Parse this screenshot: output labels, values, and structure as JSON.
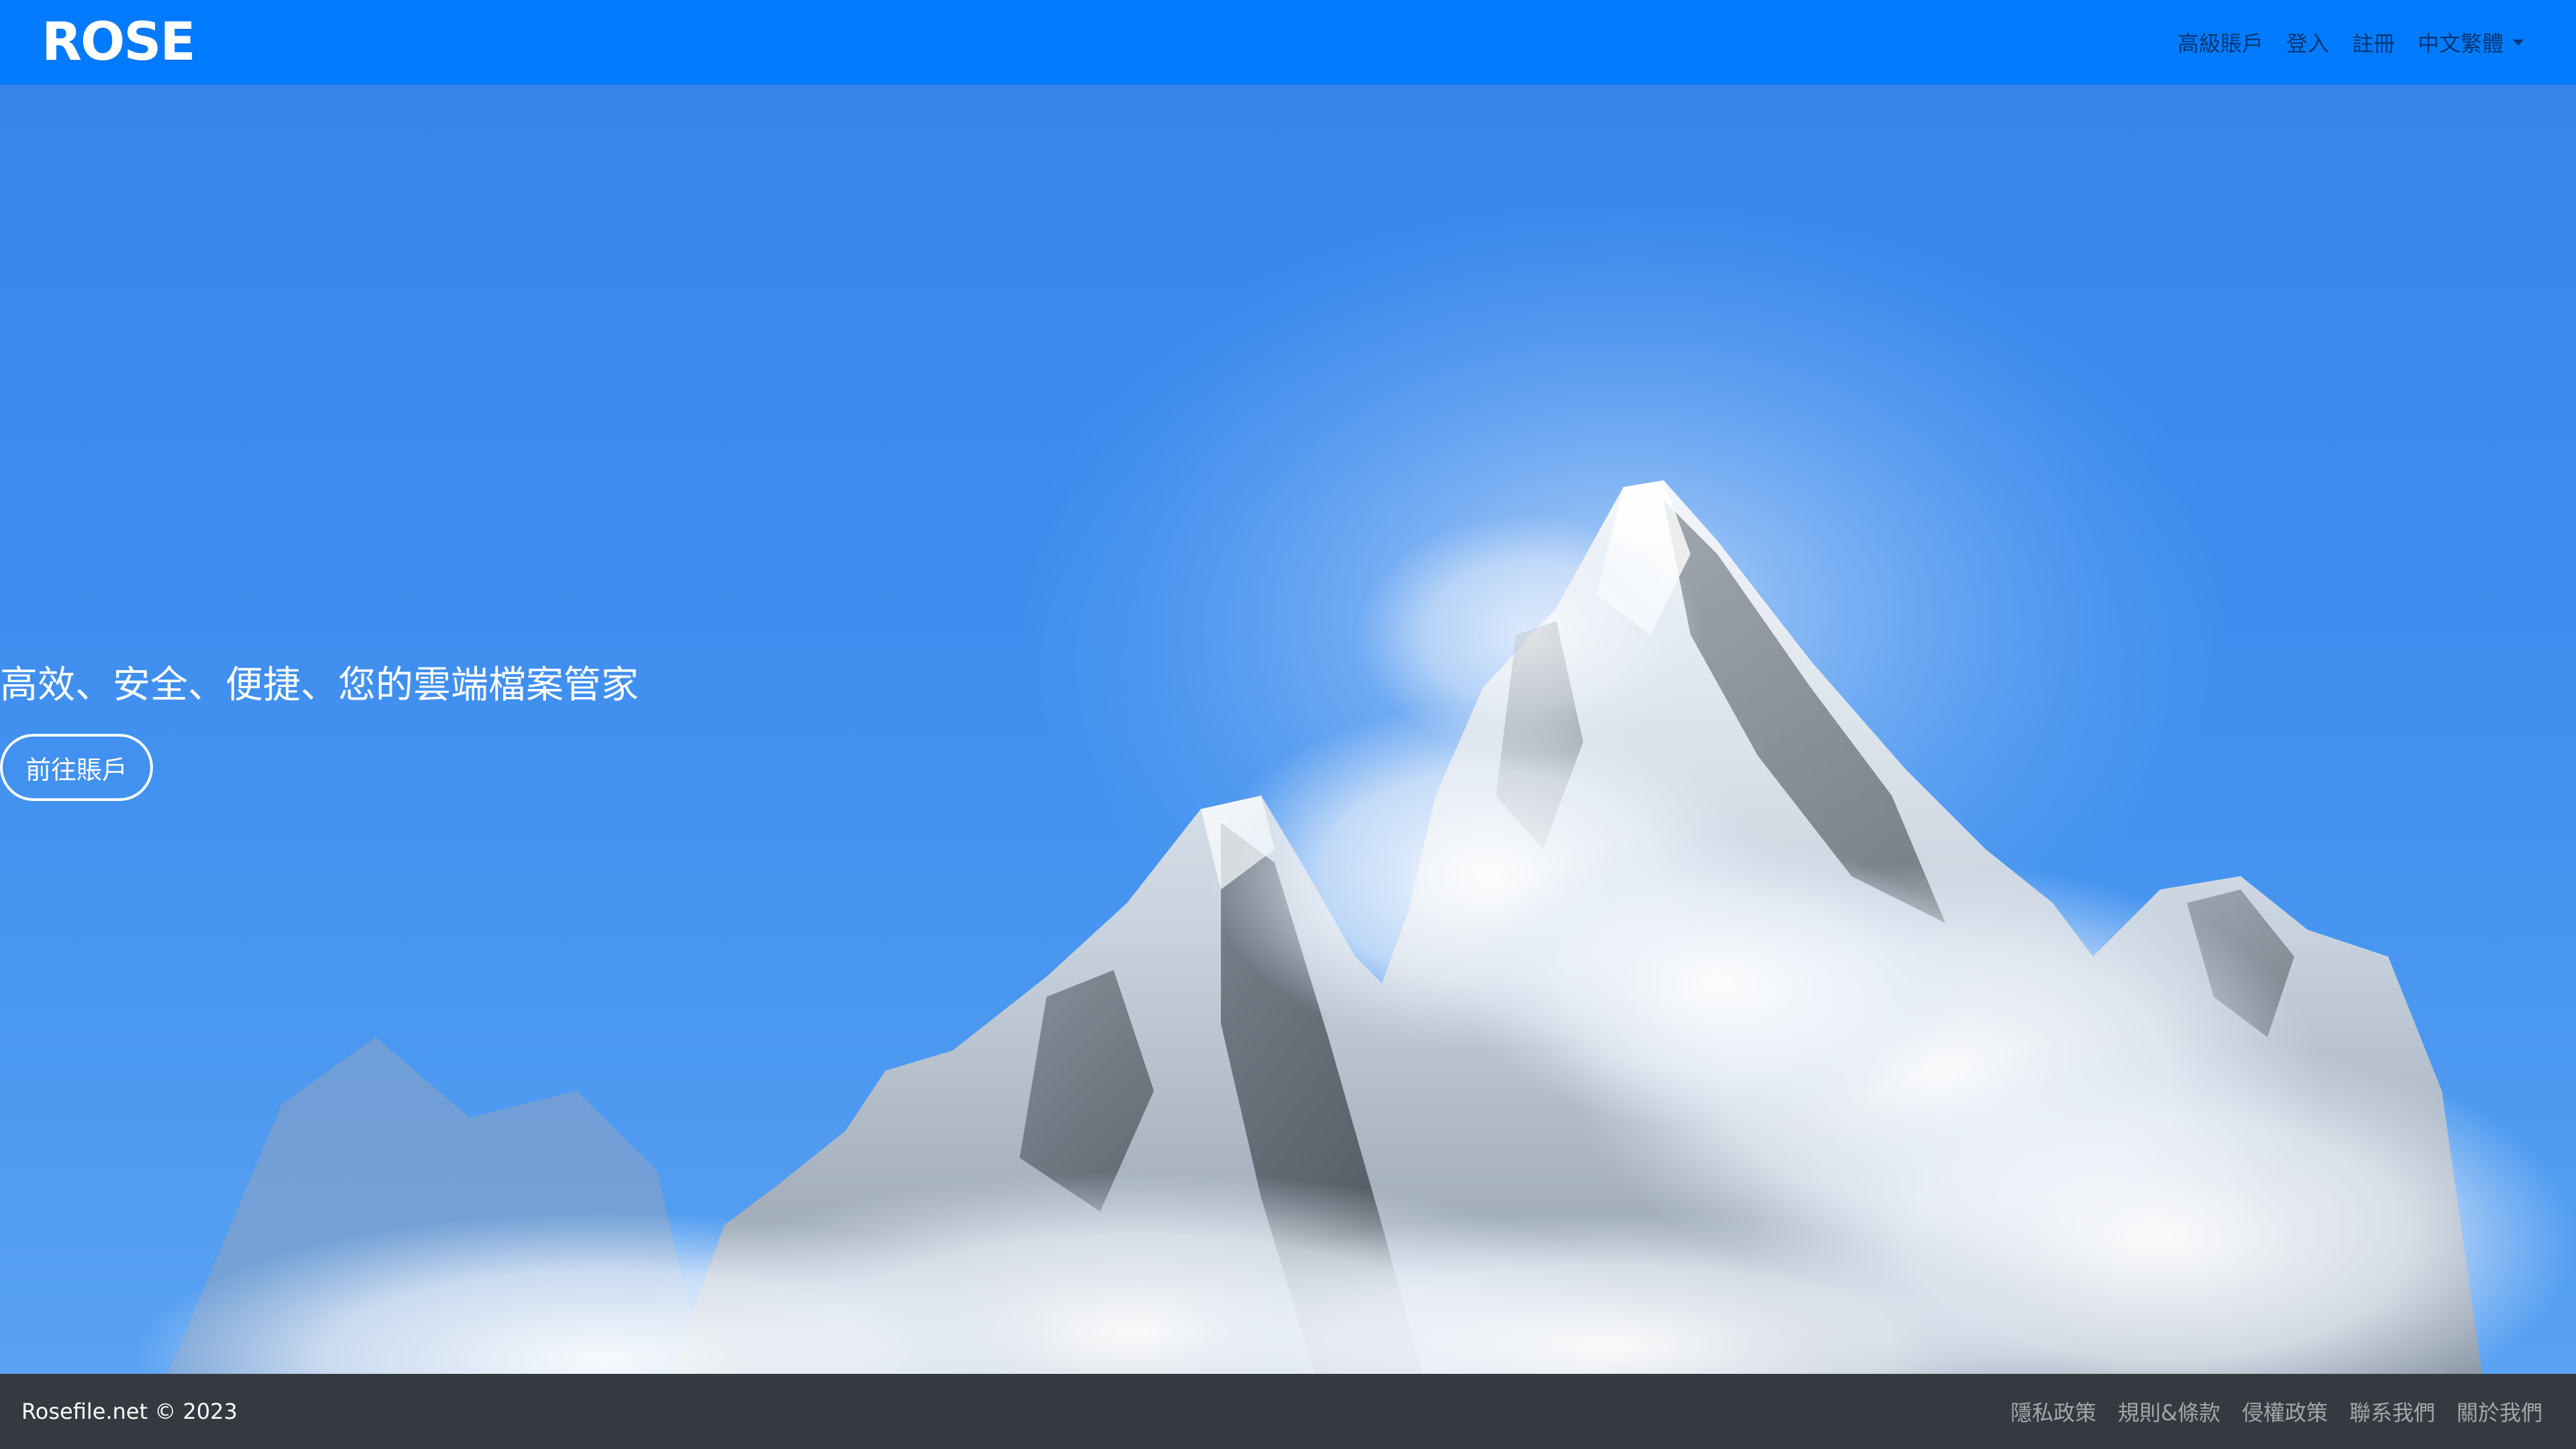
{
  "navbar": {
    "brand": "ROSE",
    "links": {
      "premium": "高級賬戶",
      "login": "登入",
      "register": "註冊",
      "language": "中文繁體"
    }
  },
  "hero": {
    "title": "高效、安全、便捷、您的雲端檔案管家",
    "button_label": "前往賬戶"
  },
  "footer": {
    "copyright": "Rosefile.net © 2023",
    "links": {
      "privacy": "隱私政策",
      "terms": "規則&條款",
      "copyright_policy": "侵權政策",
      "contact": "聯系我們",
      "about": "關於我們"
    }
  },
  "colors": {
    "navbar_bg": "#017bfe",
    "hero_sky": "#3d8bee",
    "footer_bg": "#343a40"
  }
}
